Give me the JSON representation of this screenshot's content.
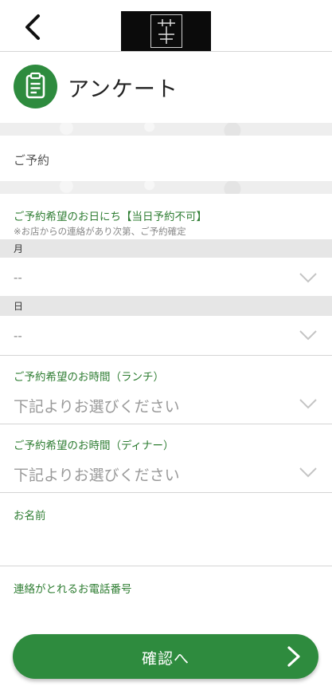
{
  "header": {
    "back_icon": "chevron-left-icon",
    "logo_icon": "brand-logo"
  },
  "page": {
    "title": "アンケート",
    "title_icon": "clipboard-icon"
  },
  "form": {
    "section_heading": "ご予約",
    "date_label": "ご予約希望のお日にち【当日予約不可】",
    "date_note": "※お店からの連絡があり次第、ご予約確定",
    "month_label": "月",
    "month_value": "--",
    "day_label": "日",
    "day_value": "--",
    "lunch_label": "ご予約希望のお時間（ランチ）",
    "lunch_placeholder": "下記よりお選びください",
    "dinner_label": "ご予約希望のお時間（ディナー）",
    "dinner_placeholder": "下記よりお選びください",
    "name_label": "お名前",
    "name_value": "",
    "phone_label": "連絡がとれるお電話番号",
    "phone_value": ""
  },
  "footer": {
    "confirm_label": "確認へ",
    "confirm_icon": "chevron-right-icon"
  },
  "colors": {
    "accent": "#2e8b3e",
    "label_green": "#2e7d32"
  }
}
